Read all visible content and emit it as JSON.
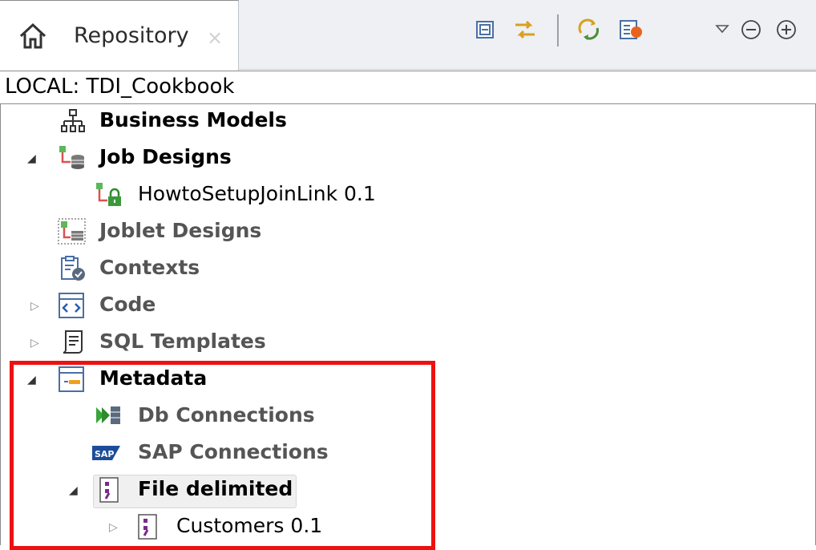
{
  "tab": {
    "title": "Repository",
    "close_glyph": "×",
    "home_icon": "home-icon"
  },
  "toolbar": {
    "buttons": [
      {
        "name": "collapse-all-icon"
      },
      {
        "name": "link-with-editor-icon"
      },
      {
        "name": "refresh-icon"
      },
      {
        "name": "filter-settings-icon"
      },
      {
        "name": "view-menu-icon"
      },
      {
        "name": "minimize-icon"
      },
      {
        "name": "maximize-icon"
      }
    ]
  },
  "project": {
    "label": "LOCAL: TDI_Cookbook"
  },
  "tree": {
    "items": [
      {
        "label": "Business Models",
        "icon": "business-models-icon",
        "expander": "none"
      },
      {
        "label": "Job Designs",
        "icon": "job-designs-icon",
        "expander": "expanded"
      },
      {
        "label": "HowtoSetupJoinLink 0.1",
        "icon": "locked-job-icon",
        "expander": "none"
      },
      {
        "label": "Joblet Designs",
        "icon": "joblet-designs-icon",
        "expander": "none"
      },
      {
        "label": "Contexts",
        "icon": "contexts-icon",
        "expander": "none"
      },
      {
        "label": "Code",
        "icon": "code-icon",
        "expander": "collapsed"
      },
      {
        "label": "SQL Templates",
        "icon": "sql-templates-icon",
        "expander": "collapsed"
      },
      {
        "label": "Metadata",
        "icon": "metadata-icon",
        "expander": "expanded"
      },
      {
        "label": "Db Connections",
        "icon": "db-connections-icon",
        "expander": "none"
      },
      {
        "label": "SAP Connections",
        "icon": "sap-connections-icon",
        "expander": "none",
        "badge": "SAP"
      },
      {
        "label": "File delimited",
        "icon": "file-delimited-icon",
        "expander": "expanded"
      },
      {
        "label": "Customers 0.1",
        "icon": "file-delimited-icon",
        "expander": "collapsed"
      }
    ]
  },
  "colors": {
    "highlight": "#ee1111",
    "accent": "#7a2a8c"
  }
}
